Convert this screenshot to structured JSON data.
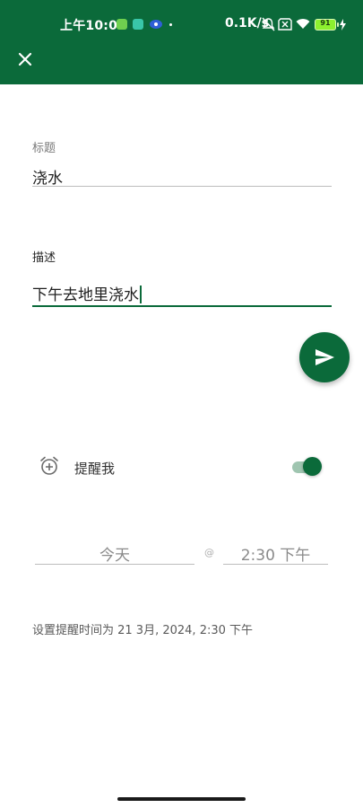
{
  "status_bar": {
    "time": "上午10:04",
    "network_speed": "0.1K/s",
    "battery_level": "91",
    "icons": [
      "notification-app-icon",
      "shield-icon",
      "vpn-icon",
      "silent-bell-icon",
      "sim-x-icon",
      "wifi-icon",
      "battery-icon",
      "charging-icon"
    ]
  },
  "toolbar": {
    "close_icon": "close-icon"
  },
  "form": {
    "title_label": "标题",
    "title_value": "浇水",
    "description_label": "描述",
    "description_value": "下午去地里浇水"
  },
  "reminder": {
    "label": "提醒我",
    "enabled": true,
    "date": "今天",
    "separator": "@",
    "time": "2:30 下午",
    "summary": "设置提醒时间为 21 3月, 2024, 2:30 下午"
  },
  "colors": {
    "primary": "#0b6a3a",
    "switch_track": "#9fc5b0"
  }
}
